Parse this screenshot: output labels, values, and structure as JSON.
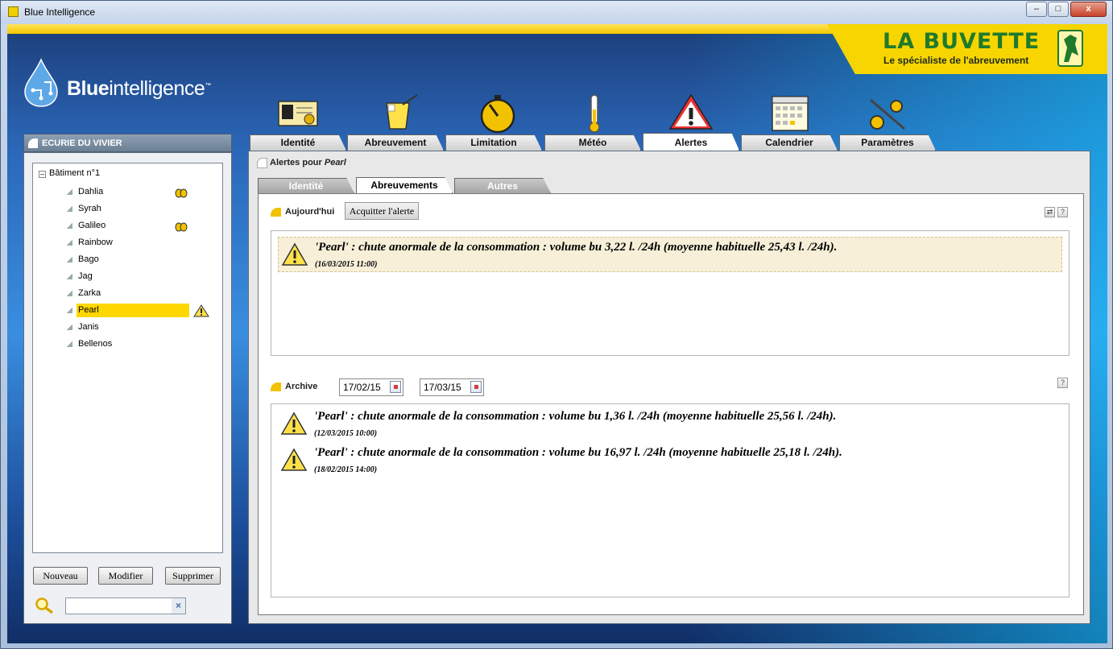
{
  "window": {
    "title": "Blue Intelligence",
    "min_label": "–",
    "max_label": "□",
    "close_label": "x"
  },
  "brand": {
    "name": "LA BUVETTE",
    "tagline": "Le spécialiste de l'abreuvement"
  },
  "logo": {
    "part1": "Blue",
    "part2": "intelligence",
    "tm": "™"
  },
  "main_tabs": [
    {
      "label": "Identité",
      "icon": "id-card-icon"
    },
    {
      "label": "Abreuvement",
      "icon": "drink-glass-icon"
    },
    {
      "label": "Limitation",
      "icon": "gauge-icon"
    },
    {
      "label": "Météo",
      "icon": "thermometer-icon"
    },
    {
      "label": "Alertes",
      "icon": "warning-icon",
      "active": true
    },
    {
      "label": "Calendrier",
      "icon": "calendar-icon"
    },
    {
      "label": "Paramètres",
      "icon": "settings-gears-icon"
    }
  ],
  "sidebar": {
    "header": "ECURIE DU VIVIER",
    "root": "Bâtiment n°1",
    "items": [
      {
        "label": "Dahlia",
        "badge": "bee"
      },
      {
        "label": "Syrah"
      },
      {
        "label": "Galileo",
        "badge": "bee"
      },
      {
        "label": "Rainbow"
      },
      {
        "label": "Bago"
      },
      {
        "label": "Jag"
      },
      {
        "label": "Zarka"
      },
      {
        "label": "Pearl",
        "selected": true,
        "badge": "warning"
      },
      {
        "label": "Janis"
      },
      {
        "label": "Bellenos"
      }
    ],
    "buttons": {
      "new": "Nouveau",
      "edit": "Modifier",
      "delete": "Supprimer"
    },
    "search": {
      "value": "",
      "clear_label": "×"
    }
  },
  "content": {
    "title_prefix": "Alertes pour",
    "title_name": "Pearl",
    "sub_tabs": [
      "Identité",
      "Abreuvements",
      "Autres"
    ],
    "active_sub_tab": "Abreuvements",
    "today": {
      "label": "Aujourd'hui",
      "ack_button": "Acquitter l'alerte",
      "refresh_label": "⇄",
      "help_label": "?",
      "alerts": [
        {
          "message": "'Pearl' : chute anormale de la consommation : volume bu  3,22 l. /24h (moyenne habituelle 25,43 l. /24h).",
          "date": "(16/03/2015 11:00)"
        }
      ]
    },
    "archive": {
      "label": "Archive",
      "date_from": "17/02/15",
      "date_to": "17/03/15",
      "help_label": "?",
      "alerts": [
        {
          "message": "'Pearl' : chute anormale de la consommation : volume bu 1,36 l. /24h (moyenne habituelle 25,56 l. /24h).",
          "date": "(12/03/2015 10:00)"
        },
        {
          "message": "'Pearl' : chute anormale de la consommation : volume bu 16,97 l. /24h (moyenne habituelle 25,18 l. /24h).",
          "date": "(18/02/2015 14:00)"
        }
      ]
    }
  },
  "colors": {
    "accent_yellow": "#f7d500",
    "brand_green": "#1f7a2c",
    "selection": "#ffd700",
    "alert_bg": "#f7efd8"
  }
}
